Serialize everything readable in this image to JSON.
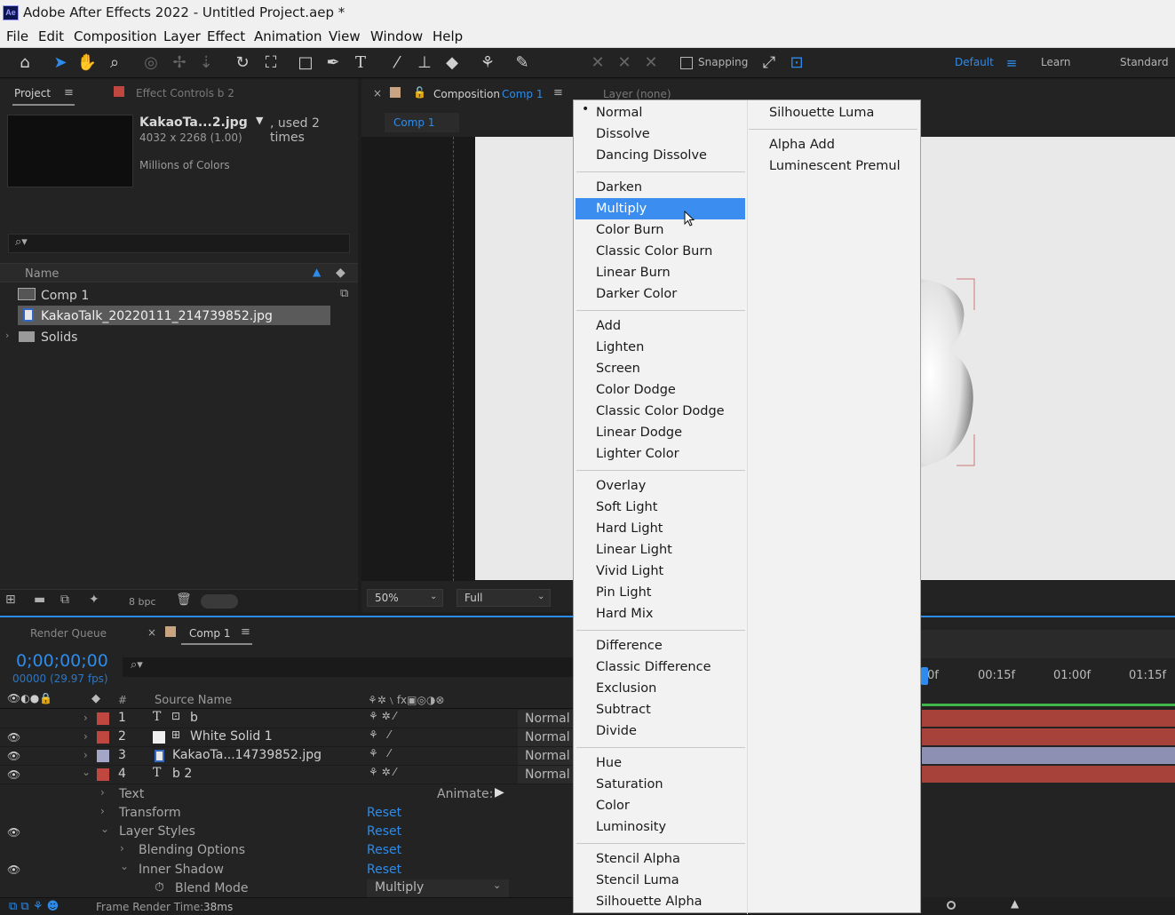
{
  "window": {
    "app_badge": "Ae",
    "title": "Adobe After Effects 2022 - Untitled Project.aep *"
  },
  "menubar": [
    "File",
    "Edit",
    "Composition",
    "Layer",
    "Effect",
    "Animation",
    "View",
    "Window",
    "Help"
  ],
  "toolbar": {
    "snapping_label": "Snapping",
    "workspace_default": "Default",
    "workspace_learn": "Learn",
    "workspace_standard": "Standard"
  },
  "project_panel": {
    "tab_project": "Project",
    "tab_effect_controls": "Effect Controls b 2",
    "file_name": "KakaoTa...2.jpg",
    "used_label": ", used 2 times",
    "dimensions": "4032 x 2268 (1.00)",
    "colors": "Millions of Colors",
    "column_name": "Name",
    "items": [
      "Comp 1",
      "KakaoTalk_20220111_214739852.jpg",
      "Solids"
    ],
    "bpc": "8 bpc"
  },
  "comp_panel": {
    "tab_label": "Composition",
    "tab_comp_name": "Comp 1",
    "subtab": "Comp 1",
    "layer_panel": "Layer (none)",
    "zoom": "50%",
    "resolution": "Full"
  },
  "timeline": {
    "tab_render_queue": "Render Queue",
    "tab_comp": "Comp 1",
    "timecode": "0;00;00;00",
    "frames": "00000 (29.97 fps)",
    "col_num": "#",
    "col_source": "Source Name",
    "layers": [
      {
        "num": "1",
        "name": "b",
        "mode": "Normal"
      },
      {
        "num": "2",
        "name": "White Solid 1",
        "mode": "Normal"
      },
      {
        "num": "3",
        "name": "KakaoTa...14739852.jpg",
        "mode": "Normal"
      },
      {
        "num": "4",
        "name": "b 2",
        "mode": "Normal"
      }
    ],
    "props": {
      "text": "Text",
      "animate": "Animate:",
      "transform": "Transform",
      "layer_styles": "Layer Styles",
      "blending_options": "Blending Options",
      "inner_shadow": "Inner Shadow",
      "blend_mode": "Blend Mode",
      "blend_mode_value": "Multiply",
      "reset": "Reset"
    },
    "ruler": [
      "0f",
      "00:15f",
      "01:00f",
      "01:15f"
    ],
    "frame_render_label": "Frame Render Time:",
    "frame_render_value": "38ms"
  },
  "blend_menu": {
    "col1": [
      [
        "Normal",
        "Dissolve",
        "Dancing Dissolve"
      ],
      [
        "Darken",
        "Multiply",
        "Color Burn",
        "Classic Color Burn",
        "Linear Burn",
        "Darker Color"
      ],
      [
        "Add",
        "Lighten",
        "Screen",
        "Color Dodge",
        "Classic Color Dodge",
        "Linear Dodge",
        "Lighter Color"
      ],
      [
        "Overlay",
        "Soft Light",
        "Hard Light",
        "Linear Light",
        "Vivid Light",
        "Pin Light",
        "Hard Mix"
      ],
      [
        "Difference",
        "Classic Difference",
        "Exclusion",
        "Subtract",
        "Divide"
      ],
      [
        "Hue",
        "Saturation",
        "Color",
        "Luminosity"
      ],
      [
        "Stencil Alpha",
        "Stencil Luma",
        "Silhouette Alpha"
      ]
    ],
    "col2": [
      [
        "Silhouette Luma"
      ],
      [
        "Alpha Add",
        "Luminescent Premul"
      ]
    ],
    "checked": "Normal",
    "highlighted": "Multiply"
  },
  "colors": {
    "accent": "#2d8ceb",
    "layer_red": "#c0473f",
    "layer_lavender": "#a4a6c8",
    "menu_highlight": "#3b8ef0"
  }
}
